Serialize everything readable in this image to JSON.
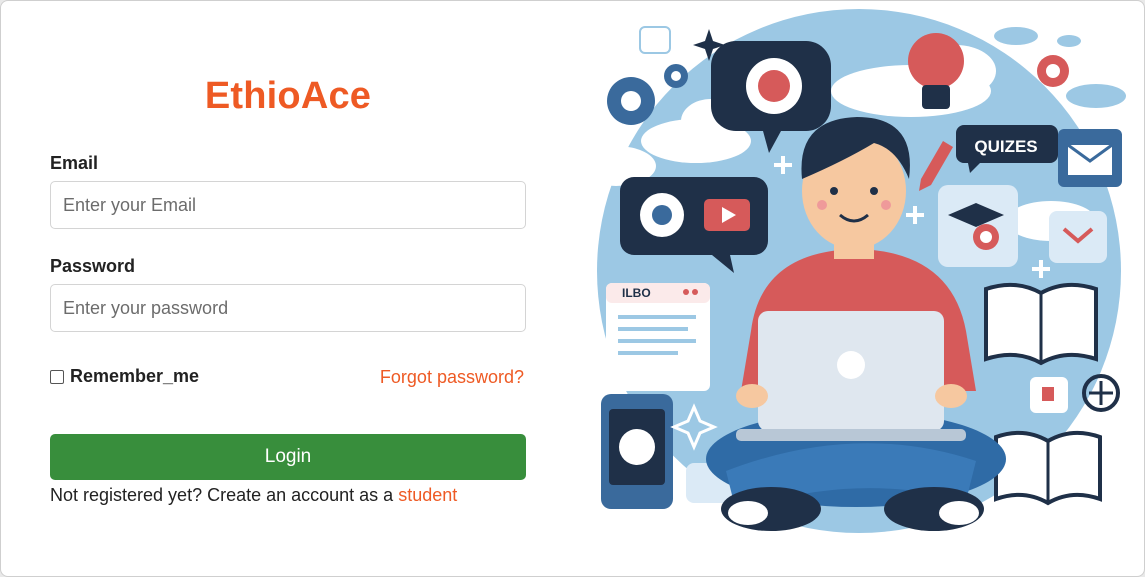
{
  "brand": {
    "title": "EthioAce"
  },
  "form": {
    "email_label": "Email",
    "email_placeholder": "Enter your Email",
    "password_label": "Password",
    "password_placeholder": "Enter your password",
    "remember_label": "Remember_me",
    "forgot_link": "Forgot password?",
    "login_button": "Login",
    "register_prompt": "Not registered yet? Create an account as a",
    "register_link": "student"
  },
  "illustration": {
    "quizes_sign": "QUIZES",
    "book_header": "ILBO"
  },
  "colors": {
    "accent": "#ee5a24",
    "login_green": "#388e3c",
    "illustration_blue": "#9cc8e4",
    "navy": "#1f3048",
    "shirt_red": "#d65a5a"
  }
}
